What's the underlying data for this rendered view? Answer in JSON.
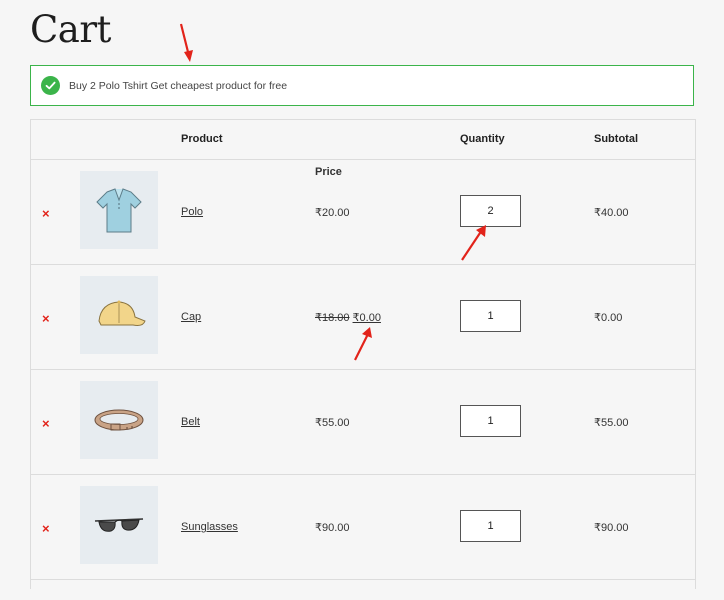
{
  "page": {
    "title": "Cart"
  },
  "notice": {
    "message": "Buy 2 Polo Tshirt Get cheapest product for free",
    "color": "#3bb44a"
  },
  "table": {
    "headers": {
      "product": "Product",
      "price": "Price",
      "quantity": "Quantity",
      "subtotal": "Subtotal"
    },
    "items": [
      {
        "name": "Polo",
        "price": "₹20.00",
        "old_price": "",
        "quantity": "2",
        "subtotal": "₹40.00",
        "icon": "polo-shirt-icon"
      },
      {
        "name": "Cap",
        "price": "₹0.00",
        "old_price": "₹18.00",
        "quantity": "1",
        "subtotal": "₹0.00",
        "icon": "cap-icon"
      },
      {
        "name": "Belt",
        "price": "₹55.00",
        "old_price": "",
        "quantity": "1",
        "subtotal": "₹55.00",
        "icon": "belt-icon"
      },
      {
        "name": "Sunglasses",
        "price": "₹90.00",
        "old_price": "",
        "quantity": "1",
        "subtotal": "₹90.00",
        "icon": "sunglasses-icon"
      }
    ],
    "remove_symbol": "×"
  },
  "annotation_color": "#e2231a"
}
